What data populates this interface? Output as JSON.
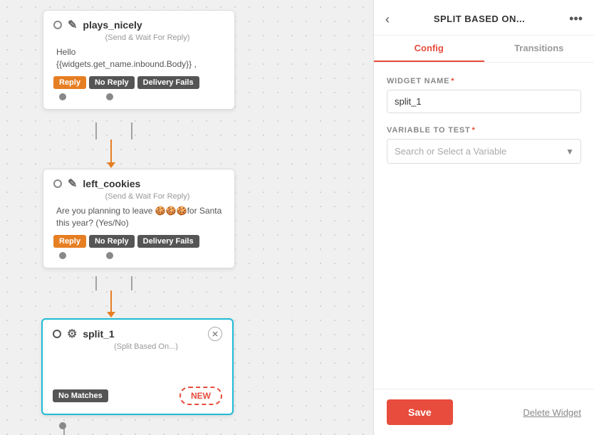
{
  "canvas": {
    "node1": {
      "name": "plays_nicely",
      "subtype": "(Send & Wait For Reply)",
      "body": "Hello\n{{widgets.get_name.inbound.Body}} ,",
      "tags": [
        "Reply",
        "No Reply",
        "Delivery Fails"
      ]
    },
    "node2": {
      "name": "left_cookies",
      "subtype": "(Send & Wait For Reply)",
      "body": "Are you planning to leave 🍪🍪🍪for Santa this year? (Yes/No)",
      "tags": [
        "Reply",
        "No Reply",
        "Delivery Fails"
      ]
    },
    "node3": {
      "name": "split_1",
      "subtype": "(Split Based On...)",
      "no_matches": "No Matches",
      "new_btn": "NEW"
    }
  },
  "panel": {
    "title": "SPLIT BASED ON...",
    "back_icon": "‹",
    "more_icon": "•••",
    "tabs": [
      {
        "label": "Config",
        "active": true
      },
      {
        "label": "Transitions",
        "active": false
      }
    ],
    "widget_name_label": "WIDGET NAME",
    "widget_name_value": "split_1",
    "variable_label": "VARIABLE TO TEST",
    "variable_placeholder": "Search or Select a Variable",
    "save_label": "Save",
    "delete_label": "Delete Widget"
  }
}
